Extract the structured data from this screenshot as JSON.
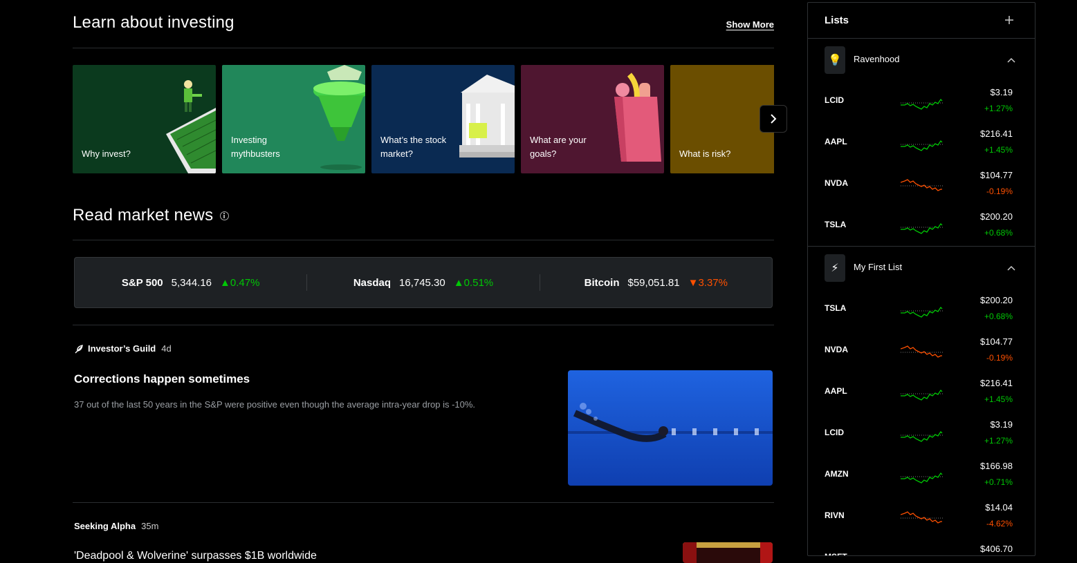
{
  "learn": {
    "title": "Learn about investing",
    "show_more": "Show More",
    "cards": [
      {
        "label": "Why invest?",
        "bg": "#0b3a1e"
      },
      {
        "label": "Investing mythbusters",
        "bg": "#21875a"
      },
      {
        "label": "What’s the stock market?",
        "bg": "#0a2a52"
      },
      {
        "label": "What are your goals?",
        "bg": "#4f1630"
      },
      {
        "label": "What is risk?",
        "bg": "#6b4e00"
      }
    ],
    "next_icon": "chevron-right-icon"
  },
  "news": {
    "title": "Read market news",
    "indices": [
      {
        "name": "S&P 500",
        "value": "5,344.16",
        "change": "0.47%",
        "dir": "up"
      },
      {
        "name": "Nasdaq",
        "value": "16,745.30",
        "change": "0.51%",
        "dir": "up"
      },
      {
        "name": "Bitcoin",
        "value": "$59,051.81",
        "change": "3.37%",
        "dir": "down"
      }
    ],
    "articles": [
      {
        "source": "Investor’s Guild",
        "age": "4d",
        "headline": "Corrections happen sometimes",
        "summary": "37 out of the last 50 years in the S&P were positive even though the average intra-year drop is -10%."
      },
      {
        "source": "Seeking Alpha",
        "age": "35m",
        "headline": "'Deadpool & Wolverine' surpasses $1B worldwide"
      }
    ]
  },
  "sidebar": {
    "title": "Lists",
    "lists": [
      {
        "name": "Ravenhood",
        "emoji": "💡",
        "stocks": [
          {
            "symbol": "LCID",
            "price": "$3.19",
            "change": "+1.27%",
            "dir": "up"
          },
          {
            "symbol": "AAPL",
            "price": "$216.41",
            "change": "+1.45%",
            "dir": "up"
          },
          {
            "symbol": "NVDA",
            "price": "$104.77",
            "change": "-0.19%",
            "dir": "down"
          },
          {
            "symbol": "TSLA",
            "price": "$200.20",
            "change": "+0.68%",
            "dir": "up"
          }
        ]
      },
      {
        "name": "My First List",
        "emoji": "⚡",
        "stocks": [
          {
            "symbol": "TSLA",
            "price": "$200.20",
            "change": "+0.68%",
            "dir": "up"
          },
          {
            "symbol": "NVDA",
            "price": "$104.77",
            "change": "-0.19%",
            "dir": "down"
          },
          {
            "symbol": "AAPL",
            "price": "$216.41",
            "change": "+1.45%",
            "dir": "up"
          },
          {
            "symbol": "LCID",
            "price": "$3.19",
            "change": "+1.27%",
            "dir": "up"
          },
          {
            "symbol": "AMZN",
            "price": "$166.98",
            "change": "+0.71%",
            "dir": "up"
          },
          {
            "symbol": "RIVN",
            "price": "$14.04",
            "change": "-4.62%",
            "dir": "down"
          },
          {
            "symbol": "MSFT",
            "price": "$406.70",
            "change": "",
            "dir": "up"
          }
        ]
      }
    ]
  },
  "colors": {
    "up": "#00c805",
    "down": "#ff5000",
    "panel": "#1e2124"
  }
}
